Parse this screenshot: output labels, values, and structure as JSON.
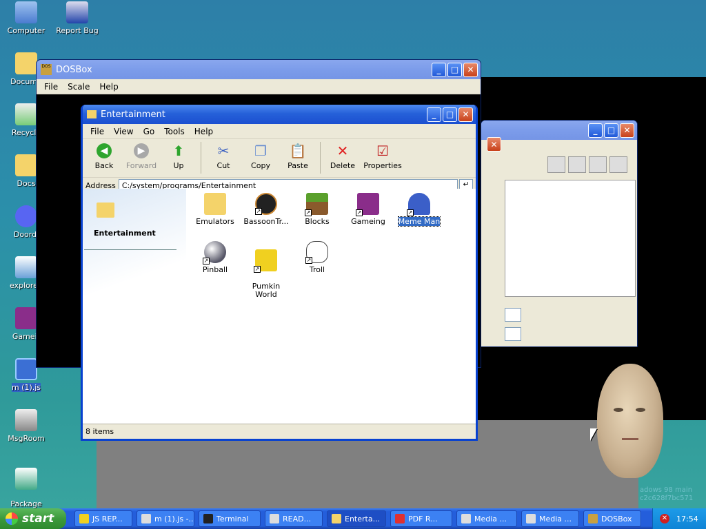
{
  "desktop": {
    "icons": [
      {
        "label": "Computer",
        "icon": "computer-icon"
      },
      {
        "label": "Report Bug",
        "icon": "report-bug-icon"
      },
      {
        "label": "Docume",
        "icon": "documents-folder-icon"
      },
      {
        "label": "Recycle",
        "icon": "recycle-bin-icon"
      },
      {
        "label": "Docs",
        "icon": "folder-icon"
      },
      {
        "label": "Doordi",
        "icon": "discord-icon"
      },
      {
        "label": "explorer.",
        "icon": "explorer-icon"
      },
      {
        "label": "Gameir",
        "icon": "game-cube-icon"
      },
      {
        "label": "m (1).js",
        "icon": "js-file-icon"
      },
      {
        "label": "MsgRoom",
        "icon": "msgroom-icon"
      },
      {
        "label": "Package\nManager",
        "icon": "package-manager-icon"
      }
    ],
    "watermark": [
      "adows 98 main",
      "c2c628f7bc571"
    ]
  },
  "dosbox": {
    "title": "DOSBox",
    "menu": [
      "File",
      "Scale",
      "Help"
    ]
  },
  "explorer": {
    "title": "Entertainment",
    "menu": [
      "File",
      "View",
      "Go",
      "Tools",
      "Help"
    ],
    "toolbar": [
      {
        "label": "Back",
        "icon": "back-arrow-icon",
        "enabled": true
      },
      {
        "label": "Forward",
        "icon": "forward-arrow-icon",
        "enabled": false
      },
      {
        "label": "Up",
        "icon": "up-folder-icon",
        "enabled": true
      },
      {
        "label": "Cut",
        "icon": "scissors-icon",
        "enabled": true
      },
      {
        "label": "Copy",
        "icon": "copy-icon",
        "enabled": true
      },
      {
        "label": "Paste",
        "icon": "paste-icon",
        "enabled": true
      },
      {
        "label": "Delete",
        "icon": "delete-x-icon",
        "enabled": true
      },
      {
        "label": "Properties",
        "icon": "properties-icon",
        "enabled": true
      }
    ],
    "address_label": "Address",
    "address_value": "C:/system/programs/Entertainment",
    "sidepanel_title": "Entertainment",
    "items": [
      {
        "label": "Emulators",
        "icon": "folder-icon",
        "shortcut": false,
        "color": "#f4d36a"
      },
      {
        "label": "BassoonTr...",
        "icon": "bassoon-logo-icon",
        "shortcut": true,
        "color": "#222222"
      },
      {
        "label": "Blocks",
        "icon": "grass-block-icon",
        "shortcut": true,
        "color": "#5aa02c"
      },
      {
        "label": "Gameing",
        "icon": "game-cube-icon",
        "shortcut": true,
        "color": "#8a2d8a"
      },
      {
        "label": "Meme Man",
        "icon": "meme-man-icon",
        "shortcut": true,
        "color": "#3b5fc8",
        "selected": true
      },
      {
        "label": "Pinball",
        "icon": "pinball-icon",
        "shortcut": true,
        "color": "#9aa0b0"
      },
      {
        "label": "Pumkin\nWorld",
        "icon": "pumkin-face-icon",
        "shortcut": true,
        "color": "#f0d020"
      },
      {
        "label": "Troll",
        "icon": "troll-face-icon",
        "shortcut": true,
        "color": "#ffffff"
      }
    ],
    "status": "8 items"
  },
  "taskbar": {
    "start_label": "start",
    "buttons": [
      {
        "label": "JS REP...",
        "icon": "js-icon"
      },
      {
        "label": "m (1).js -...",
        "icon": "document-icon"
      },
      {
        "label": "Terminal",
        "icon": "terminal-icon"
      },
      {
        "label": "READ...",
        "icon": "document-icon"
      },
      {
        "label": "Enterta...",
        "icon": "folder-icon",
        "active": true
      },
      {
        "label": "PDF R...",
        "icon": "pdf-icon"
      },
      {
        "label": "Media ...",
        "icon": "media-icon"
      },
      {
        "label": "Media ...",
        "icon": "media-icon"
      },
      {
        "label": "DOSBox",
        "icon": "dosbox-icon"
      }
    ],
    "clock": "17:54"
  },
  "colors": {
    "xp_blue": "#245edb",
    "start_green": "#3c9a3c",
    "selection": "#316ac5"
  }
}
